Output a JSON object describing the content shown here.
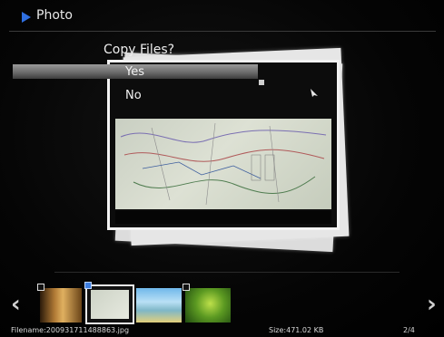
{
  "header": {
    "title": "Photo"
  },
  "dialog": {
    "title": "Copy Files?",
    "options": [
      {
        "label": "Yes",
        "selected": true
      },
      {
        "label": "No",
        "selected": false
      }
    ]
  },
  "thumbnails": [
    {
      "name": "lion",
      "checked": true
    },
    {
      "name": "map",
      "checked": true,
      "current": true
    },
    {
      "name": "beach",
      "checked": false
    },
    {
      "name": "green-leaf",
      "checked": true
    }
  ],
  "status": {
    "filename": "Filename:200931711488863.jpg",
    "size": "Size:471.02 KB",
    "page": "2/4"
  },
  "navigation": {
    "prev_icon": "chevron-left-icon",
    "next_icon": "chevron-right-icon"
  },
  "colors": {
    "accent": "#2f6fe0",
    "highlight": "#8a8a8a",
    "background": "#000000"
  }
}
